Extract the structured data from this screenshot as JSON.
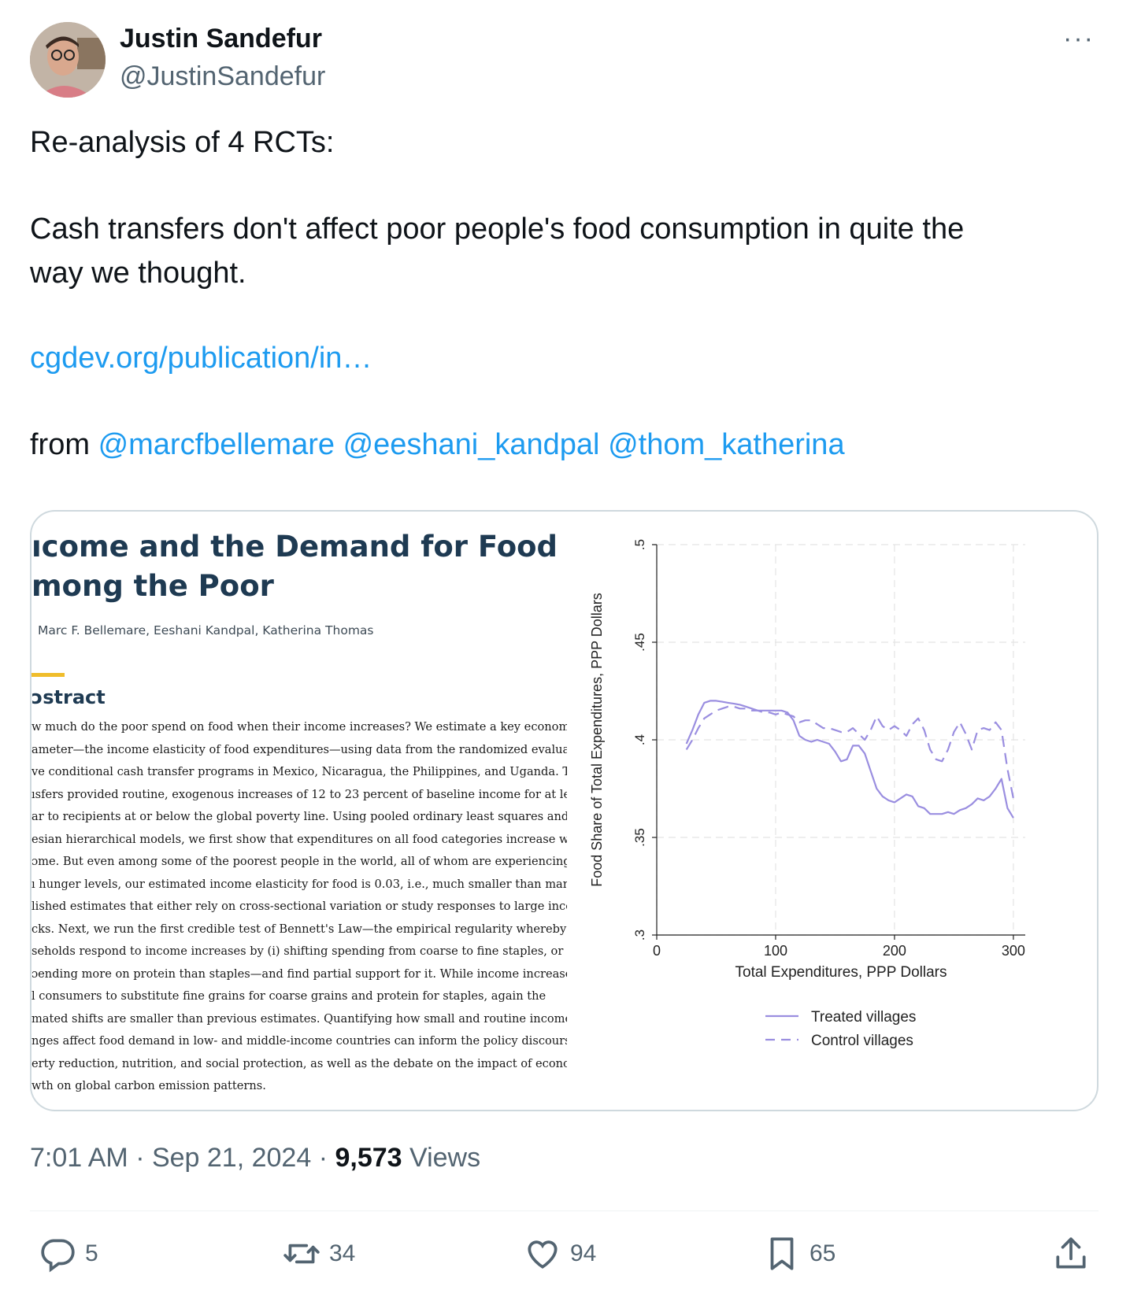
{
  "author": {
    "name": "Justin Sandefur",
    "handle": "@JustinSandefur"
  },
  "more_label": "···",
  "tweet": {
    "line1": "Re-analysis of 4 RCTs:",
    "line2": "Cash transfers don't affect poor people's food consumption in quite the",
    "line3": "way we thought.",
    "link": "cgdev.org/publication/in…",
    "from_label": "from",
    "mentions": [
      "@marcfbellemare",
      "@eeshani_kandpal",
      "@thom_katherina"
    ]
  },
  "paper": {
    "title_line1": "ıcome and the Demand for Food",
    "title_line2": "mong the Poor",
    "authors": "Marc F. Bellemare, Eeshani Kandpal, Katherina Thomas",
    "abstract_heading": "ɔstract",
    "abstract_lines": [
      "w much do the poor spend on food when their income increases? We estimate a key economic",
      "ameter—the income elasticity of food expenditures—using data from the randomized evaluati",
      "ve conditional cash transfer programs in Mexico, Nicaragua, the Philippines, and Uganda. The",
      "ısfers provided routine, exogenous increases of 12 to 23 percent of baseline income for at least",
      "ar to recipients at or below the global poverty line. Using pooled ordinary least squares and",
      "esian hierarchical models, we first show that expenditures on all food categories increase witl",
      "ɔme. But even among some of the poorest people in the world, all of whom are experiencing",
      "ı hunger levels, our estimated income elasticity for food is 0.03, i.e., much smaller than many",
      "lished estimates that either rely on cross-sectional variation or study responses to large incon",
      "cks. Next, we run the first credible test of Bennett's Law—the empirical regularity whereby poc",
      "seholds respond to income increases by (i) shifting spending from coarse to fine staples, or",
      "ɔending more on protein than staples—and find partial support for it. While income increases",
      "l consumers to substitute fine grains for coarse grains and protein for staples, again the",
      "mated shifts are smaller than previous estimates. Quantifying how small and routine income",
      "nges affect food demand in low- and middle-income countries can inform the policy discourse",
      "erty reduction, nutrition, and social protection, as well as the debate on the impact of economi",
      "wth on global carbon emission patterns."
    ]
  },
  "chart_data": {
    "type": "line",
    "xlabel": "Total Expenditures, PPP Dollars",
    "ylabel": "Food Share of Total Expenditures, PPP Dollars",
    "xlim": [
      0,
      310
    ],
    "ylim": [
      0.3,
      0.5
    ],
    "x_ticks": [
      0,
      100,
      200,
      300
    ],
    "x_tick_labels": [
      "0",
      "100",
      "200",
      "300"
    ],
    "y_ticks": [
      0.3,
      0.35,
      0.4,
      0.45,
      0.5
    ],
    "y_tick_labels": [
      ".3",
      ".35",
      ".4",
      ".45",
      ".5"
    ],
    "grid": true,
    "legend_position": "bottom",
    "series": [
      {
        "name": "Treated villages",
        "style": "solid",
        "color": "#9a8ee0",
        "x": [
          25,
          30,
          35,
          40,
          45,
          50,
          55,
          60,
          65,
          70,
          75,
          80,
          85,
          90,
          95,
          100,
          105,
          110,
          115,
          120,
          125,
          130,
          135,
          140,
          145,
          150,
          155,
          160,
          165,
          170,
          175,
          180,
          185,
          190,
          195,
          200,
          205,
          210,
          215,
          220,
          225,
          230,
          235,
          240,
          245,
          250,
          255,
          260,
          265,
          270,
          275,
          280,
          285,
          290,
          295,
          300
        ],
        "y": [
          0.398,
          0.405,
          0.413,
          0.419,
          0.42,
          0.42,
          0.4195,
          0.419,
          0.4185,
          0.418,
          0.417,
          0.416,
          0.415,
          0.415,
          0.415,
          0.415,
          0.415,
          0.414,
          0.41,
          0.402,
          0.4,
          0.399,
          0.4,
          0.399,
          0.398,
          0.394,
          0.389,
          0.39,
          0.397,
          0.397,
          0.393,
          0.384,
          0.375,
          0.371,
          0.369,
          0.368,
          0.37,
          0.372,
          0.371,
          0.366,
          0.365,
          0.362,
          0.362,
          0.362,
          0.363,
          0.362,
          0.364,
          0.365,
          0.367,
          0.37,
          0.369,
          0.371,
          0.375,
          0.38,
          0.365,
          0.36
        ]
      },
      {
        "name": "Control villages",
        "style": "dashed",
        "color": "#9a8ee0",
        "x": [
          25,
          30,
          35,
          40,
          45,
          50,
          55,
          60,
          65,
          70,
          75,
          80,
          85,
          90,
          95,
          100,
          105,
          110,
          115,
          120,
          125,
          130,
          135,
          140,
          145,
          150,
          155,
          160,
          165,
          170,
          175,
          180,
          185,
          190,
          195,
          200,
          205,
          210,
          215,
          220,
          225,
          230,
          235,
          240,
          245,
          250,
          255,
          260,
          265,
          270,
          275,
          280,
          285,
          290,
          295,
          300
        ],
        "y": [
          0.395,
          0.4,
          0.406,
          0.411,
          0.413,
          0.415,
          0.416,
          0.417,
          0.417,
          0.416,
          0.416,
          0.415,
          0.415,
          0.414,
          0.414,
          0.413,
          0.414,
          0.413,
          0.412,
          0.409,
          0.41,
          0.41,
          0.408,
          0.406,
          0.406,
          0.405,
          0.404,
          0.404,
          0.406,
          0.403,
          0.4,
          0.405,
          0.412,
          0.407,
          0.405,
          0.407,
          0.405,
          0.402,
          0.408,
          0.411,
          0.405,
          0.395,
          0.39,
          0.389,
          0.395,
          0.404,
          0.409,
          0.403,
          0.395,
          0.405,
          0.406,
          0.405,
          0.409,
          0.405,
          0.385,
          0.37
        ]
      }
    ]
  },
  "meta": {
    "time": "7:01 AM · Sep 21, 2024 ·",
    "views_count": "9,573",
    "views_label": "Views"
  },
  "actions": {
    "replies": "5",
    "retweets": "34",
    "likes": "94",
    "bookmarks": "65"
  }
}
